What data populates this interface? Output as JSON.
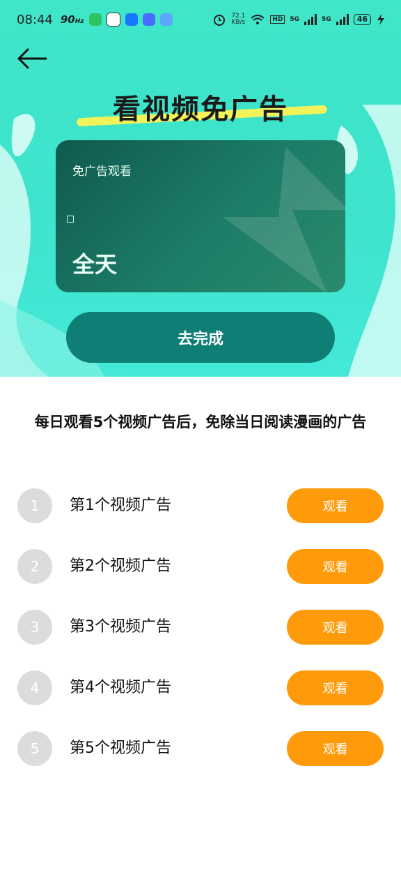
{
  "status_bar": {
    "time": "08:44",
    "refresh": "90",
    "refresh_unit": "Hz",
    "net_speed_value": "72.1",
    "net_speed_unit": "KB/s",
    "signal_label_1": "5G",
    "signal_label_2": "5G",
    "battery": "46"
  },
  "hero": {
    "title": "看视频免广告",
    "card": {
      "label": "免广告观看",
      "value": "全天"
    },
    "complete_button": "去完成"
  },
  "description": "每日观看5个视频广告后，免除当日阅读漫画的广告",
  "tasks": [
    {
      "number": "1",
      "label": "第1个视频广告",
      "button": "观看"
    },
    {
      "number": "2",
      "label": "第2个视频广告",
      "button": "观看"
    },
    {
      "number": "3",
      "label": "第3个视频广告",
      "button": "观看"
    },
    {
      "number": "4",
      "label": "第4个视频广告",
      "button": "观看"
    },
    {
      "number": "5",
      "label": "第5个视频广告",
      "button": "观看"
    }
  ],
  "colors": {
    "hero_bg": "#3fe6c8",
    "primary_button": "#0f7e74",
    "watch_button": "#ff9b0a",
    "number_circle": "#dcdcdc"
  }
}
